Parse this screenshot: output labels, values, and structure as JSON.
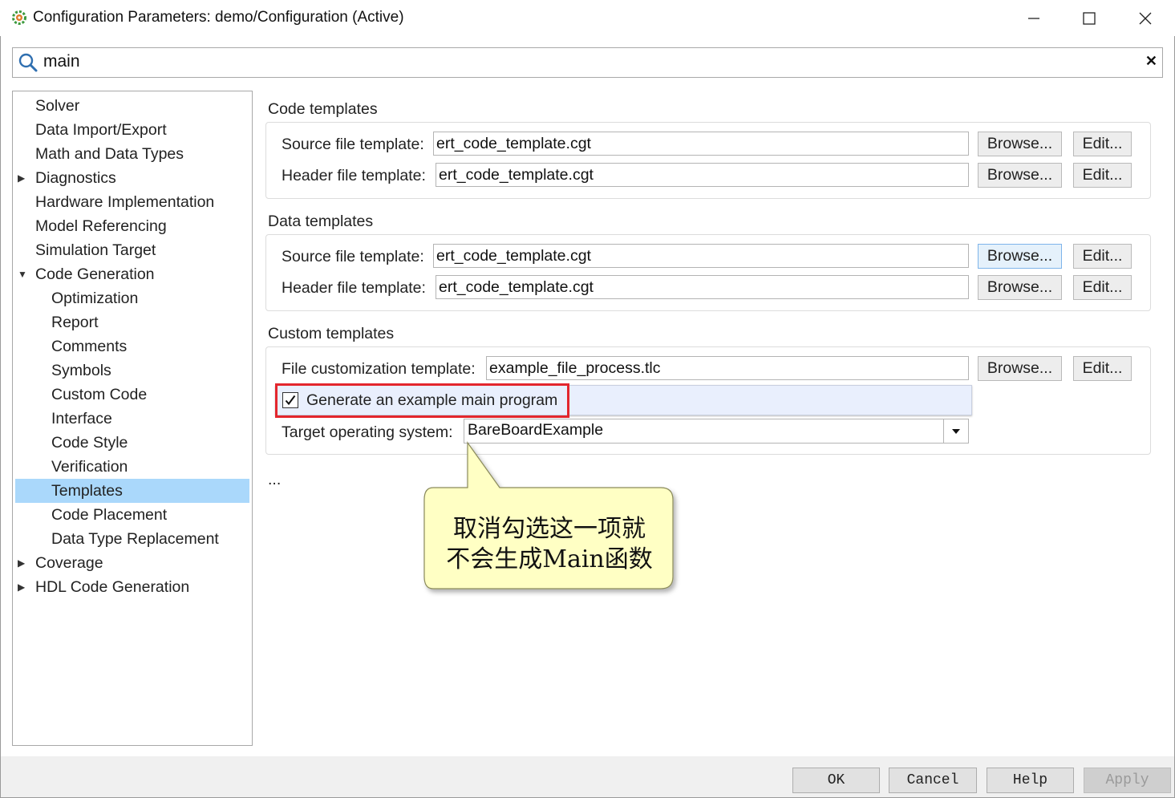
{
  "window": {
    "title": "Configuration Parameters: demo/Configuration (Active)"
  },
  "search": {
    "value": "main"
  },
  "tree": {
    "items": [
      {
        "label": "Solver",
        "level": 0,
        "arrow": ""
      },
      {
        "label": "Data Import/Export",
        "level": 0,
        "arrow": ""
      },
      {
        "label": "Math and Data Types",
        "level": 0,
        "arrow": ""
      },
      {
        "label": "Diagnostics",
        "level": 0,
        "arrow": "collapsed"
      },
      {
        "label": "Hardware Implementation",
        "level": 0,
        "arrow": ""
      },
      {
        "label": "Model Referencing",
        "level": 0,
        "arrow": ""
      },
      {
        "label": "Simulation Target",
        "level": 0,
        "arrow": ""
      },
      {
        "label": "Code Generation",
        "level": 0,
        "arrow": "expanded"
      },
      {
        "label": "Optimization",
        "level": 1,
        "arrow": ""
      },
      {
        "label": "Report",
        "level": 1,
        "arrow": ""
      },
      {
        "label": "Comments",
        "level": 1,
        "arrow": ""
      },
      {
        "label": "Symbols",
        "level": 1,
        "arrow": ""
      },
      {
        "label": "Custom Code",
        "level": 1,
        "arrow": ""
      },
      {
        "label": "Interface",
        "level": 1,
        "arrow": ""
      },
      {
        "label": "Code Style",
        "level": 1,
        "arrow": ""
      },
      {
        "label": "Verification",
        "level": 1,
        "arrow": ""
      },
      {
        "label": "Templates",
        "level": 1,
        "arrow": "",
        "selected": true
      },
      {
        "label": "Code Placement",
        "level": 1,
        "arrow": ""
      },
      {
        "label": "Data Type Replacement",
        "level": 1,
        "arrow": ""
      },
      {
        "label": "Coverage",
        "level": 0,
        "arrow": "collapsed"
      },
      {
        "label": "HDL Code Generation",
        "level": 0,
        "arrow": "collapsed"
      }
    ]
  },
  "code_templates": {
    "title": "Code templates",
    "source_label": "Source file template:",
    "source_value": "ert_code_template.cgt",
    "header_label": "Header file template:",
    "header_value": "ert_code_template.cgt"
  },
  "data_templates": {
    "title": "Data templates",
    "source_label": "Source file template:",
    "source_value": "ert_code_template.cgt",
    "header_label": "Header file template:",
    "header_value": "ert_code_template.cgt"
  },
  "custom_templates": {
    "title": "Custom templates",
    "file_label": "File customization template:",
    "file_value": "example_file_process.tlc",
    "generate_main_label": "Generate an example main program",
    "generate_main_checked": true,
    "os_label": "Target operating system:",
    "os_value": "BareBoardExample"
  },
  "buttons": {
    "browse": "Browse...",
    "edit": "Edit..."
  },
  "ellipsis": "...",
  "callout": {
    "line1": "取消勾选这一项就",
    "line2": "不会生成Main函数"
  },
  "dialog": {
    "ok": "OK",
    "cancel": "Cancel",
    "help": "Help",
    "apply": "Apply"
  },
  "colors": {
    "selection": "#aad8fb",
    "highlight_box": "#e3262d",
    "callout_fill": "#ffffc4"
  }
}
